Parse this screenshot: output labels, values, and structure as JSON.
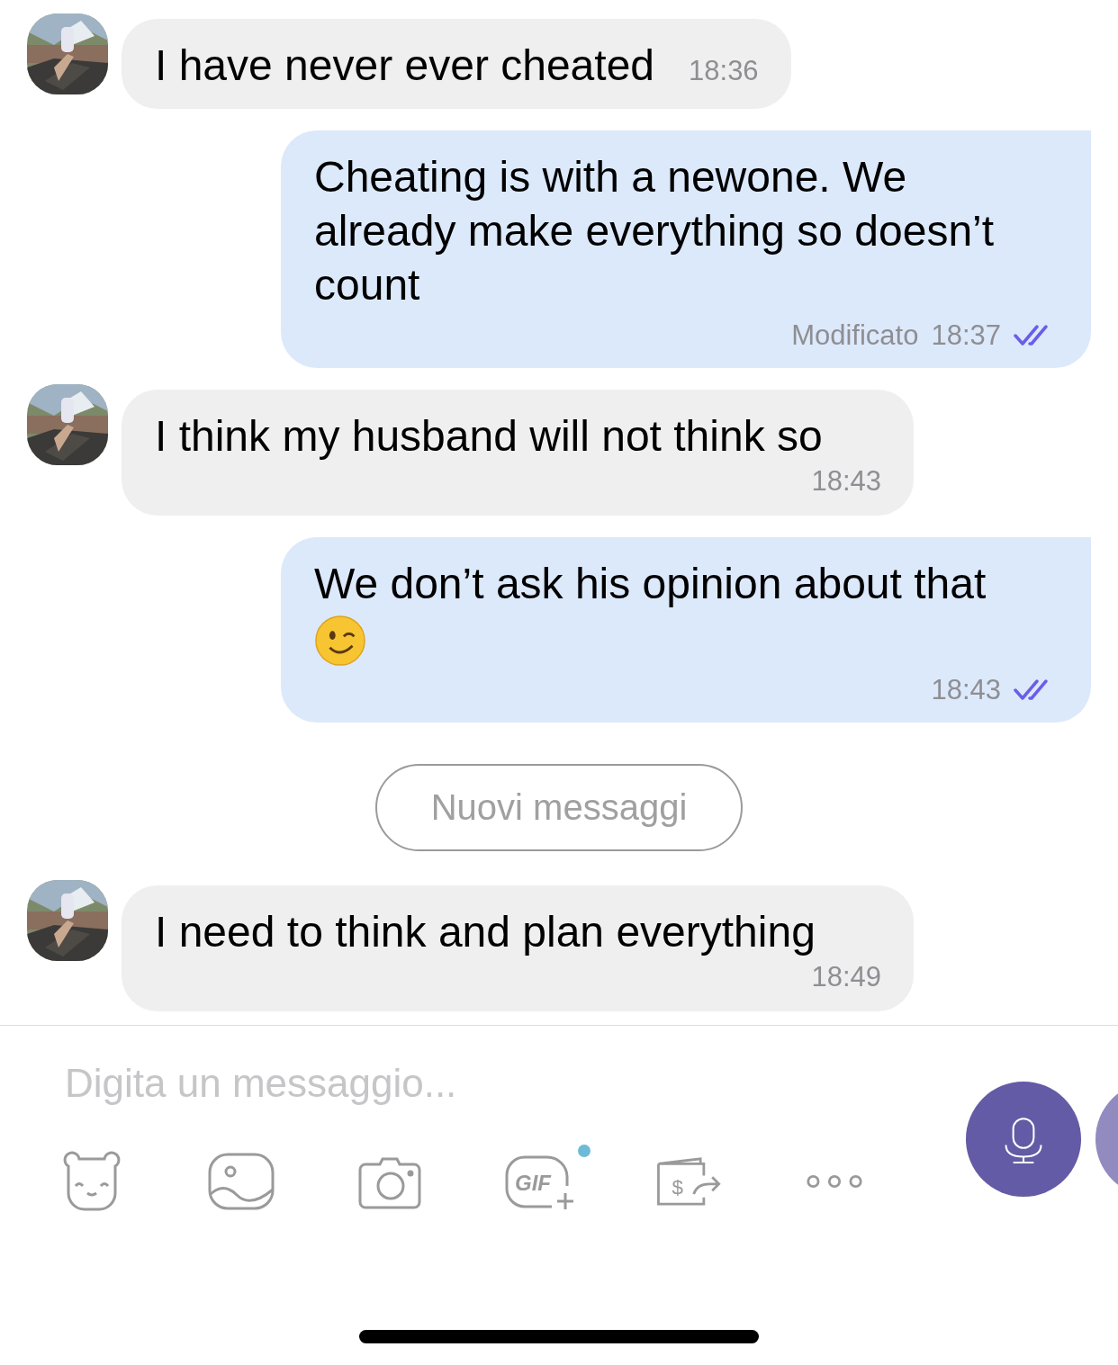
{
  "messages": [
    {
      "kind": "incoming",
      "text": "I have never ever cheated",
      "time": "18:36"
    },
    {
      "kind": "outgoing",
      "text": "Cheating is with a newone. We already make everything so doesn’t count",
      "edited": "Modificato",
      "time": "18:37",
      "read": true
    },
    {
      "kind": "incoming",
      "text": "I think my husband will not think so",
      "time": "18:43"
    },
    {
      "kind": "outgoing",
      "text": "We don’t ask his opinion about that",
      "emoji": true,
      "time": "18:43",
      "read": true
    },
    {
      "kind": "divider",
      "text": "Nuovi messaggi"
    },
    {
      "kind": "incoming",
      "text": "I need to think and plan everything",
      "time": "18:49"
    }
  ],
  "composer": {
    "placeholder": "Digita un messaggio...",
    "tools": [
      {
        "kind": "sticker"
      },
      {
        "kind": "gallery"
      },
      {
        "kind": "camera"
      },
      {
        "kind": "gif",
        "label": "GIF",
        "notify": true
      },
      {
        "kind": "money",
        "label": "$"
      },
      {
        "kind": "more"
      }
    ]
  }
}
